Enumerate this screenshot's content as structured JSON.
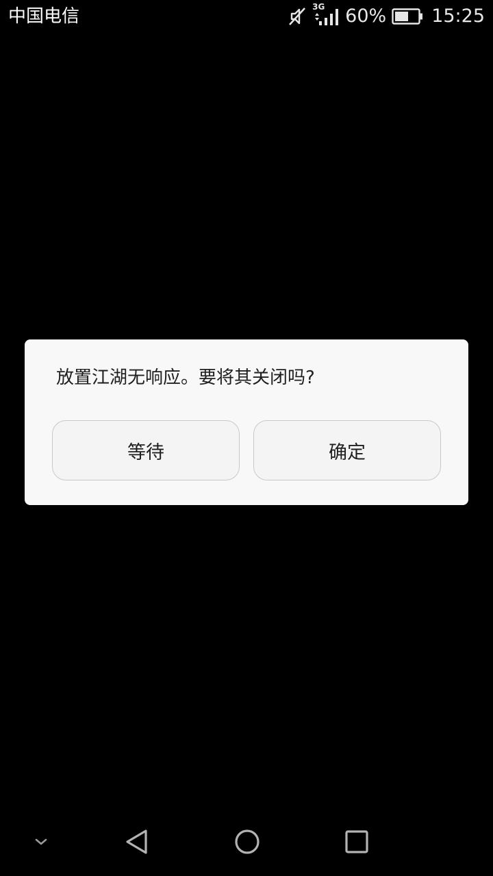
{
  "status_bar": {
    "carrier": "中国电信",
    "network_type": "3G",
    "battery_percent": "60%",
    "time": "15:25",
    "icons": [
      "mute-icon",
      "signal-icon",
      "battery-icon"
    ]
  },
  "dialog": {
    "message": "放置江湖无响应。要将其关闭吗?",
    "buttons": {
      "wait_label": "等待",
      "ok_label": "确定"
    }
  },
  "nav_bar": {
    "icons": [
      "chevron-down-icon",
      "back-icon",
      "home-icon",
      "recent-apps-icon"
    ]
  },
  "colors": {
    "background": "#000000",
    "dialog_background": "#f8f8f8",
    "button_background": "#f4f4f4",
    "button_border": "#c8c8c8",
    "text": "#1f1f1f",
    "status_text": "#ffffff"
  }
}
